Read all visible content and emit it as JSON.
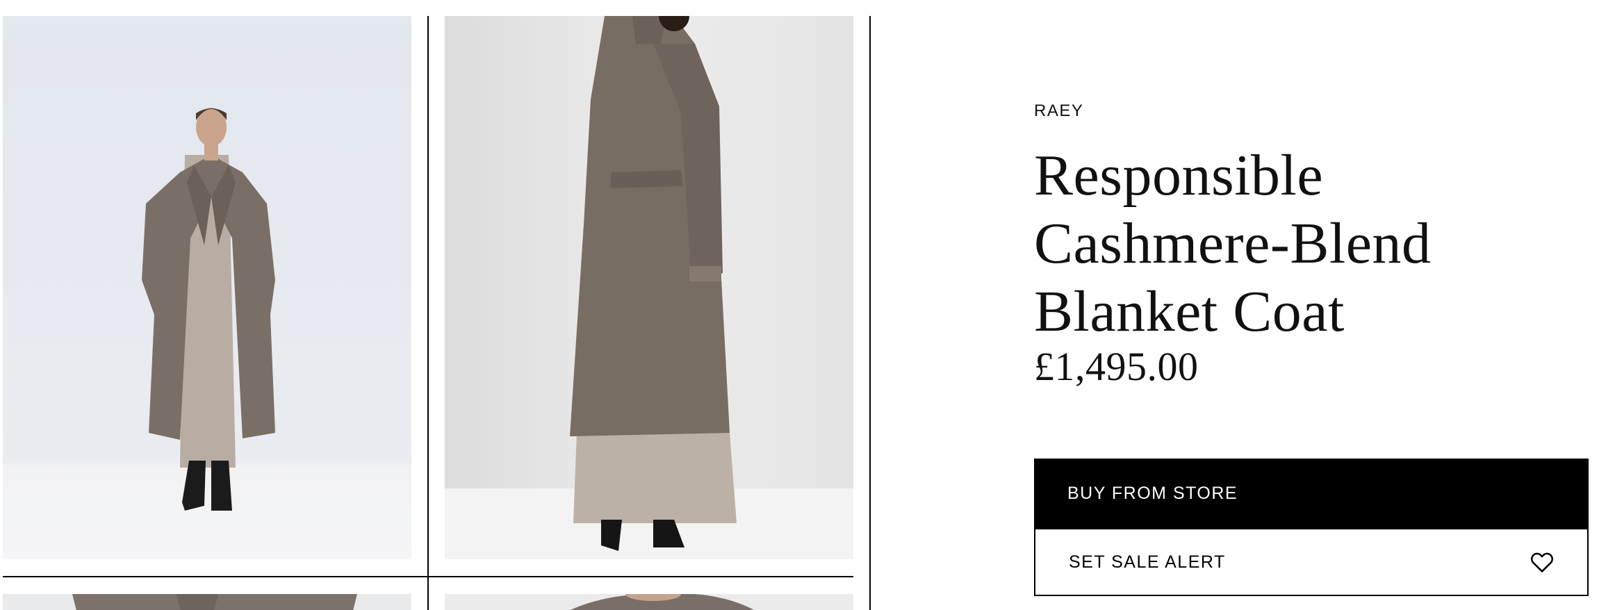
{
  "product": {
    "brand": "RAEY",
    "title": "Responsible Cashmere-Blend Blanket Coat",
    "price": "£1,495.00"
  },
  "actions": {
    "buy_label": "BUY FROM STORE",
    "alert_label": "SET SALE ALERT",
    "alert_icon": "heart-icon"
  },
  "gallery": {
    "images": [
      {
        "name": "product-image-front"
      },
      {
        "name": "product-image-back"
      },
      {
        "name": "product-image-detail-1"
      },
      {
        "name": "product-image-detail-2"
      }
    ]
  },
  "colors": {
    "coat": "#7a6f66",
    "dress": "#b8aca2",
    "backdrop": "#e6e8ec",
    "button_bg": "#000000",
    "button_text": "#ffffff"
  }
}
